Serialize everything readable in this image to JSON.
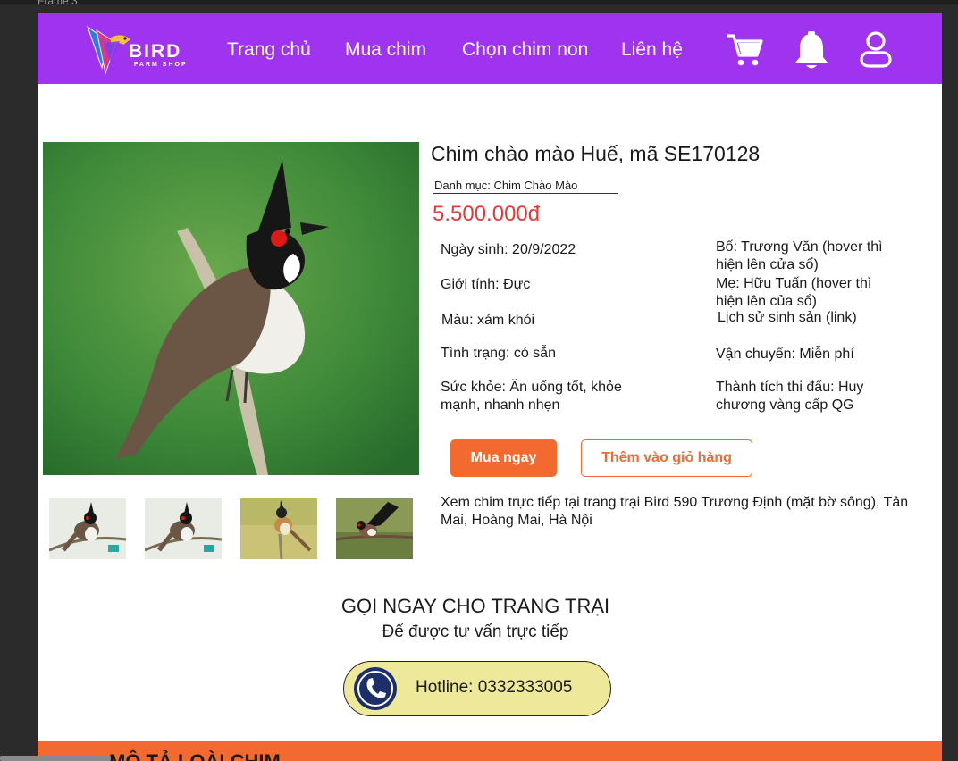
{
  "frame": {
    "label": "Frame 3"
  },
  "brand": {
    "name": "BIRD",
    "sub": "FARM SHOP",
    "colors": {
      "nav": "#a033f0",
      "accent": "#f26a30",
      "price": "#e53935",
      "hotline_bg": "#ede89a"
    }
  },
  "nav": {
    "items": [
      "Trang chủ",
      "Mua chim",
      "Chọn chim non",
      "Liên hệ"
    ],
    "icons": [
      "cart-icon",
      "bell-icon",
      "user-icon"
    ]
  },
  "product": {
    "title": "Chim chào mào Huế, mã SE170128",
    "category": "Danh mục: Chim Chào Mào",
    "price": "5.500.000đ",
    "specs_left": [
      "Ngày sinh: 20/9/2022",
      "Giới tính: Đực",
      "Màu: xám khói",
      "Tình trạng: có sẵn",
      "Sức khỏe: Ăn uống tốt, khỏe mạnh, nhanh nhẹn"
    ],
    "specs_right": [
      "Bố: Trương Văn (hover thì hiện lên cửa sổ)",
      "Mẹ: Hữu Tuấn (hover thì hiện lên của sổ)",
      "Lịch sử sinh sản (link)",
      "Vận chuyển: Miễn phí",
      "Thành tích thi đấu: Huy chương vàng cấp QG"
    ],
    "buy_label": "Mua ngay",
    "add_to_cart_label": "Thêm vào giỏ hàng",
    "visit_note": "Xem chim trực tiếp tại trang trại Bird 590 Trương Định (mặt bờ sông), Tân Mai, Hoàng Mai, Hà Nội"
  },
  "call": {
    "title": "GỌI NGAY CHO TRANG TRẠI",
    "subtitle": "Để được tư vấn trực tiếp",
    "hotline": "Hotline: 0332333005"
  },
  "description": {
    "title": "MÔ TẢ LOÀI CHIM"
  }
}
